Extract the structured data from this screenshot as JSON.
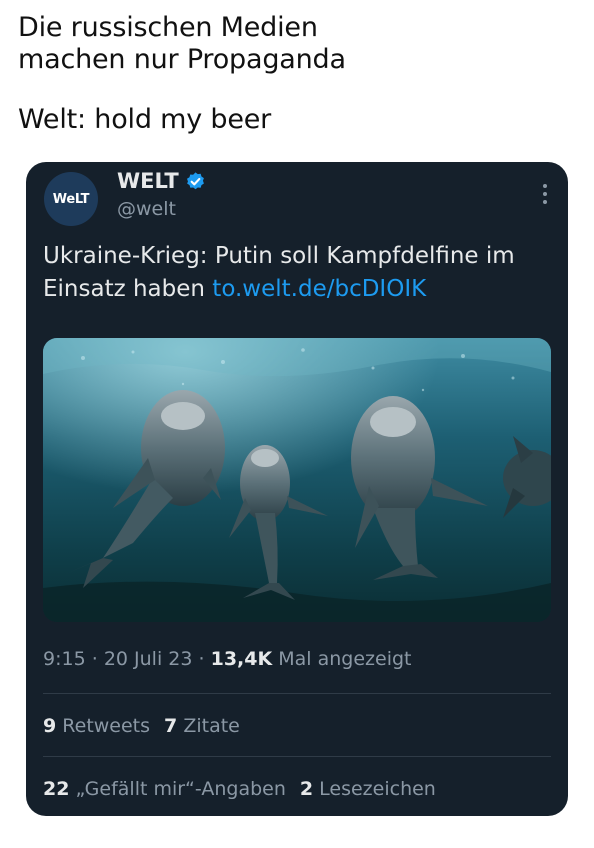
{
  "caption": {
    "line1": "Die russischen Medien",
    "line2": "machen nur Propaganda",
    "line3": "Welt: hold my beer"
  },
  "tweet": {
    "avatar_text": "WeLT",
    "display_name": "WELT",
    "handle": "@welt",
    "verified": true,
    "more_icon": "more-vertical-icon",
    "text": "Ukraine-Krieg: Putin soll Kampfdelfine im Einsatz haben ",
    "link": "to.welt.de/bcDIOIK",
    "media_alt": "dolphins underwater",
    "time": "9:15",
    "date": "20 Juli 23",
    "views_count": "13,4K",
    "views_label": "Mal angezeigt",
    "retweets_count": "9",
    "retweets_label": "Retweets",
    "quotes_count": "7",
    "quotes_label": "Zitate",
    "likes_count": "22",
    "likes_label": "„Gefällt mir“-Angaben",
    "bookmarks_count": "2",
    "bookmarks_label": "Lesezeichen"
  },
  "colors": {
    "card_bg": "#15202b",
    "link": "#1d9bf0",
    "muted": "#8b98a5",
    "verified": "#1d9bf0"
  }
}
